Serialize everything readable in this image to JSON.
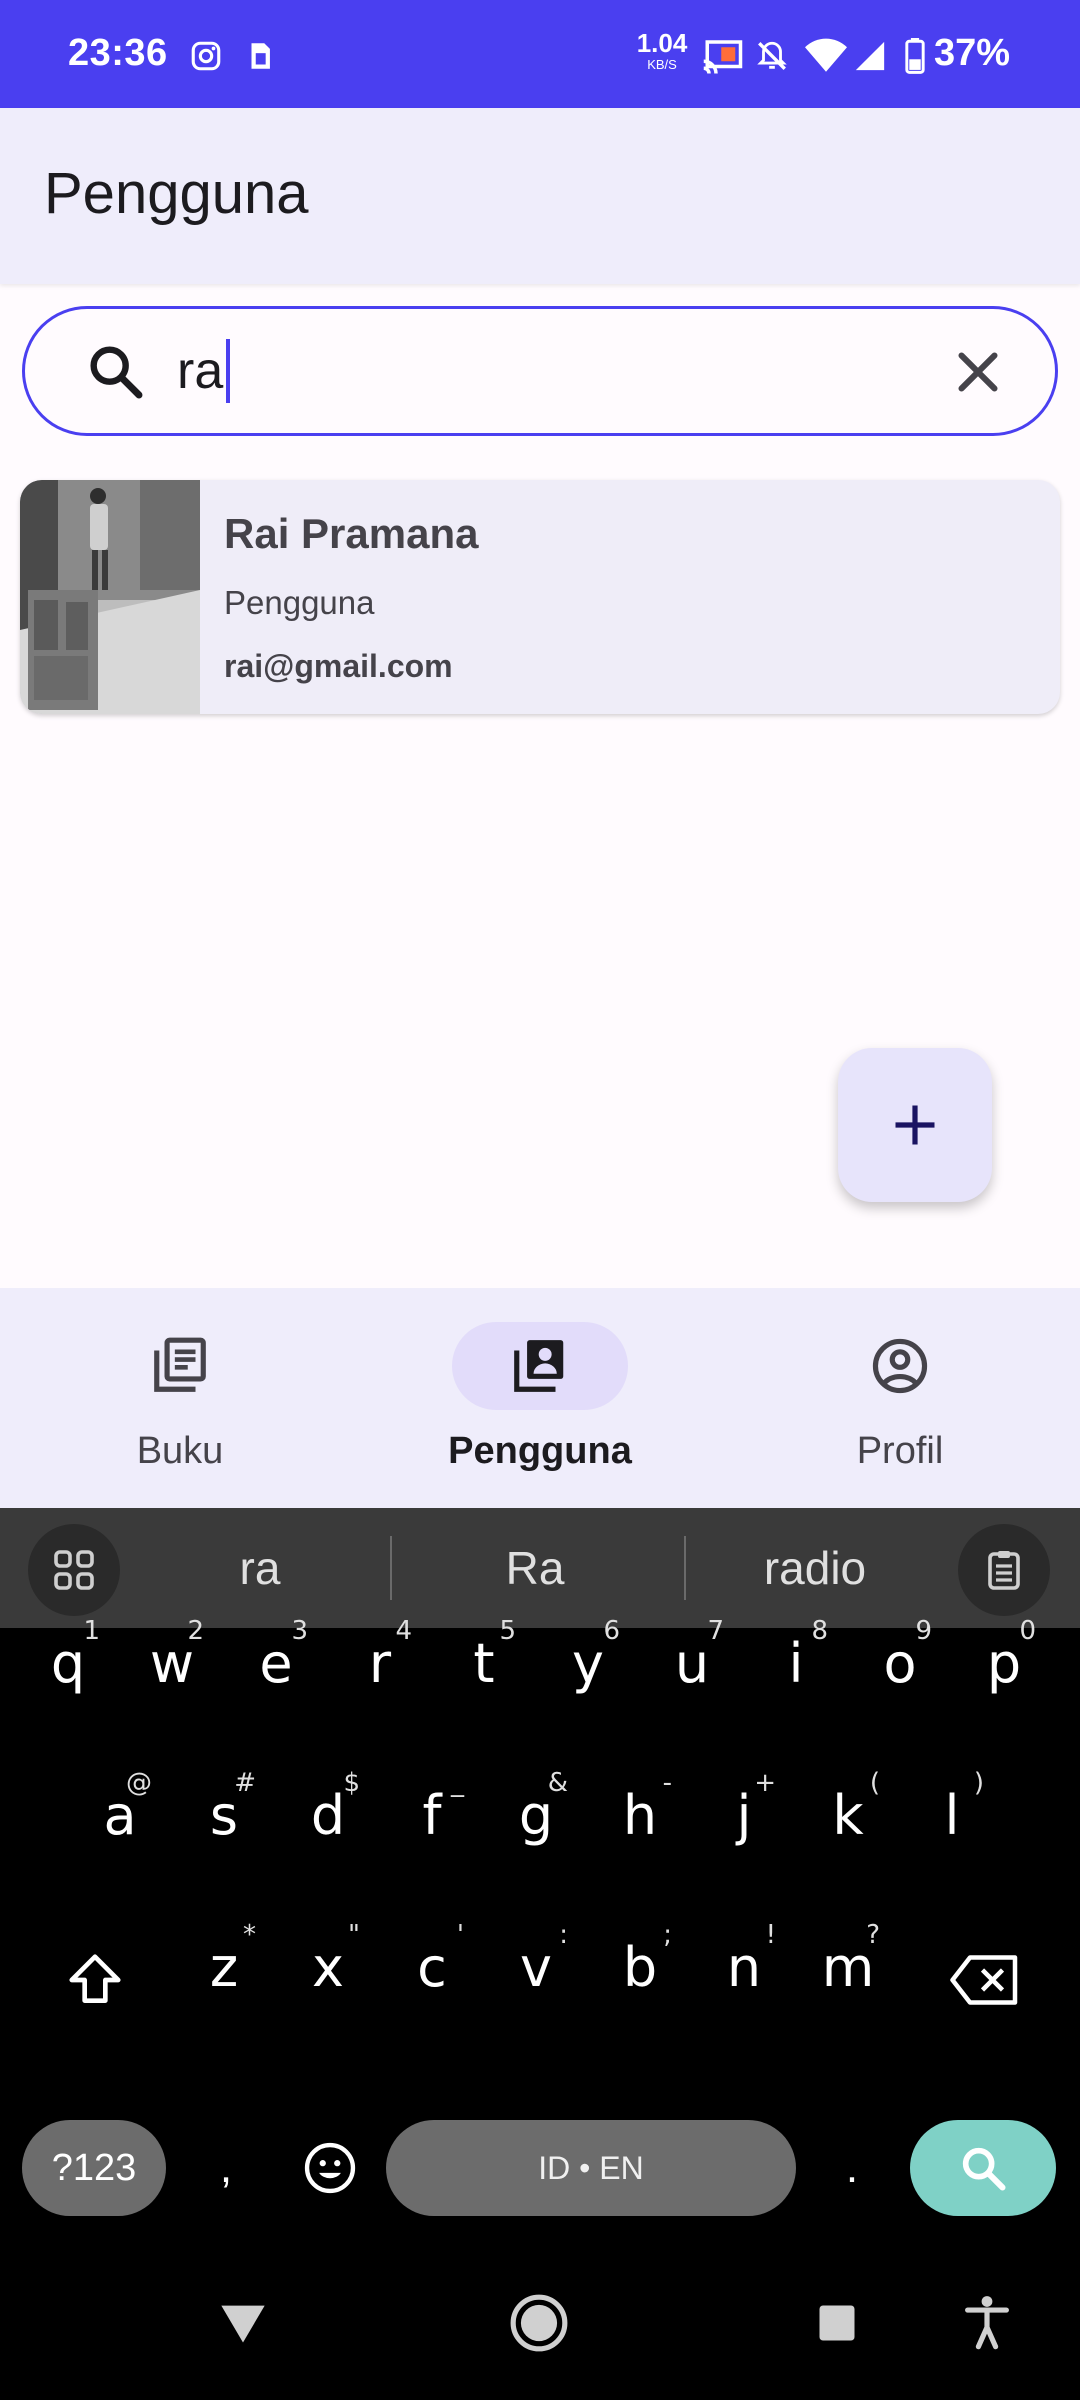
{
  "status_bar": {
    "time": "23:36",
    "net_speed": "1.04",
    "net_unit": "KB/S",
    "battery": "37%",
    "icons": [
      "instagram-icon",
      "sim-icon",
      "cast-icon",
      "mute-icon",
      "wifi-icon",
      "signal-icon",
      "battery-icon"
    ]
  },
  "app_bar": {
    "title": "Pengguna"
  },
  "search": {
    "value": "ra",
    "icon": "search-icon",
    "clear_icon": "close-icon"
  },
  "results": [
    {
      "name": "Rai Pramana",
      "role": "Pengguna",
      "email": "rai@gmail.com"
    }
  ],
  "fab": {
    "icon": "add-icon"
  },
  "bottom_nav": {
    "items": [
      {
        "label": "Buku",
        "icon": "book-icon",
        "active": false
      },
      {
        "label": "Pengguna",
        "icon": "contacts-icon",
        "active": true
      },
      {
        "label": "Profil",
        "icon": "account-circle-icon",
        "active": false
      }
    ]
  },
  "keyboard": {
    "suggestions": [
      "ra",
      "Ra",
      "radio"
    ],
    "row1": [
      {
        "c": "q",
        "h": "1"
      },
      {
        "c": "w",
        "h": "2"
      },
      {
        "c": "e",
        "h": "3"
      },
      {
        "c": "r",
        "h": "4"
      },
      {
        "c": "t",
        "h": "5"
      },
      {
        "c": "y",
        "h": "6"
      },
      {
        "c": "u",
        "h": "7"
      },
      {
        "c": "i",
        "h": "8"
      },
      {
        "c": "o",
        "h": "9"
      },
      {
        "c": "p",
        "h": "0"
      }
    ],
    "row2": [
      {
        "c": "a",
        "h": "@"
      },
      {
        "c": "s",
        "h": "#"
      },
      {
        "c": "d",
        "h": "$"
      },
      {
        "c": "f",
        "h": "_"
      },
      {
        "c": "g",
        "h": "&"
      },
      {
        "c": "h",
        "h": "-"
      },
      {
        "c": "j",
        "h": "+"
      },
      {
        "c": "k",
        "h": "("
      },
      {
        "c": "l",
        "h": ")"
      }
    ],
    "row3": [
      {
        "c": "z",
        "h": "*"
      },
      {
        "c": "x",
        "h": "\""
      },
      {
        "c": "c",
        "h": "'"
      },
      {
        "c": "v",
        "h": ":"
      },
      {
        "c": "b",
        "h": ";"
      },
      {
        "c": "n",
        "h": "!"
      },
      {
        "c": "m",
        "h": "?"
      }
    ],
    "symbols_label": "?123",
    "comma": ",",
    "space_label": "ID • EN",
    "period": ".",
    "accent": "#7fd1c6"
  },
  "colors": {
    "primary": "#4a3ff0",
    "surface": "#efedfb",
    "background": "#fffbfe"
  }
}
